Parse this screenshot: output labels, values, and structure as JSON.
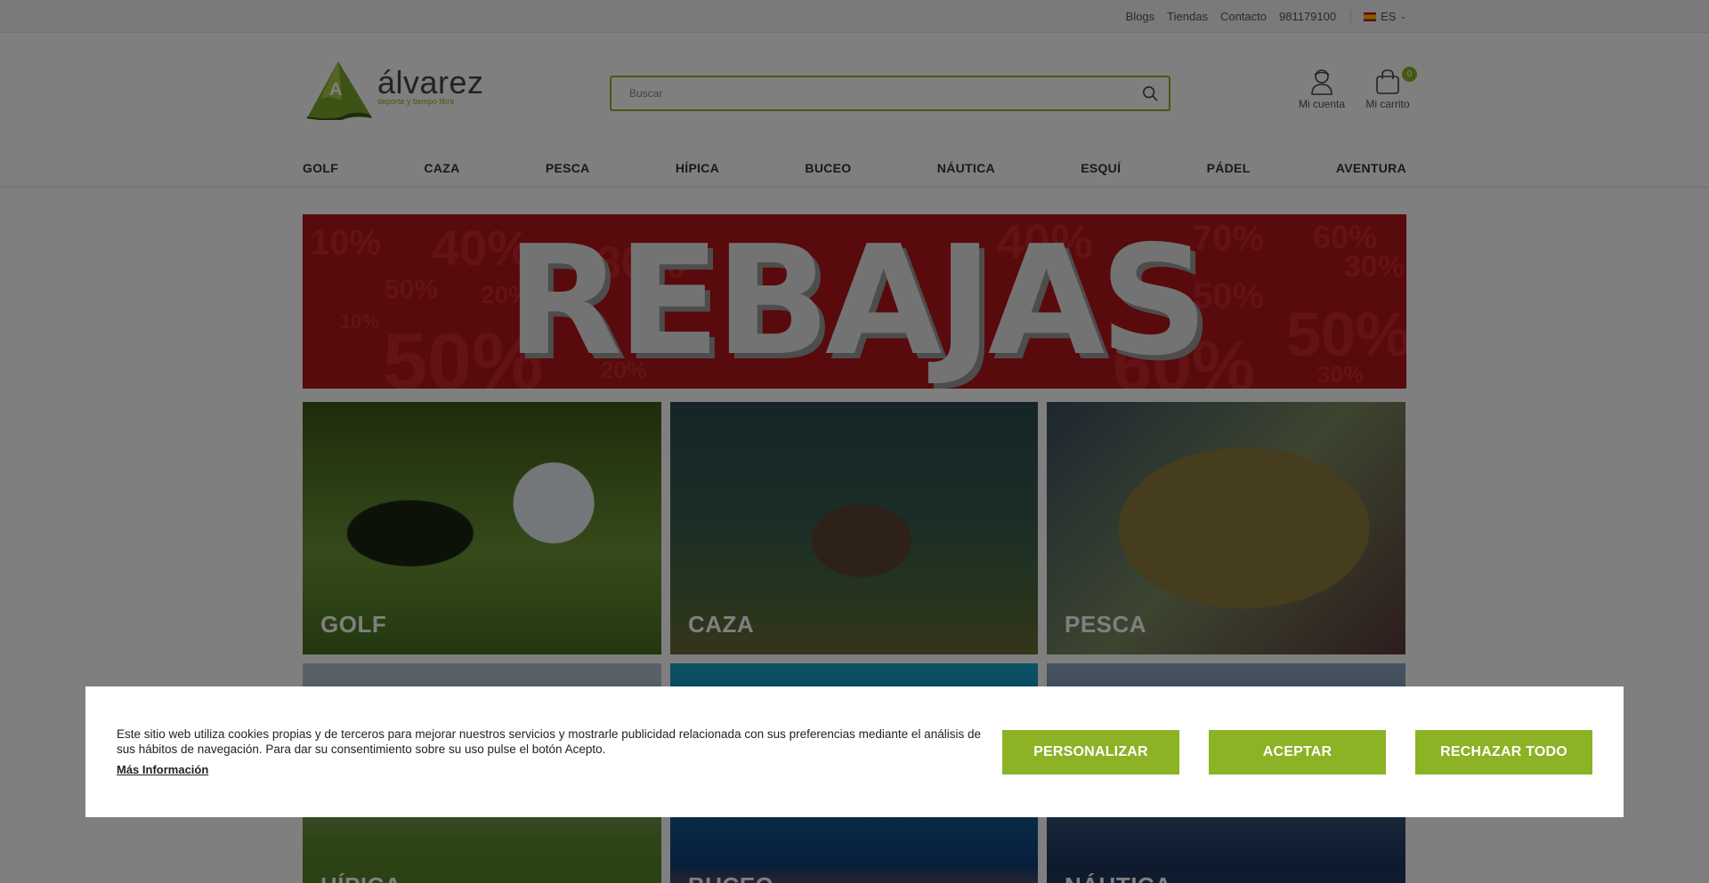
{
  "topbar": {
    "links": [
      "Blogs",
      "Tiendas",
      "Contacto",
      "981179100"
    ],
    "language": "ES"
  },
  "header": {
    "logo_word": "álvarez",
    "logo_tagline": "deporte y tiempo libre",
    "search_placeholder": "Buscar",
    "account_label": "Mi cuenta",
    "cart_label": "Mi carrito",
    "cart_count": "0"
  },
  "nav": [
    "GOLF",
    "CAZA",
    "PESCA",
    "HÍPICA",
    "BUCEO",
    "NÁUTICA",
    "ESQUÍ",
    "PÁDEL",
    "AVENTURA"
  ],
  "banner": {
    "title": "REBAJAS",
    "percentages": [
      "10%",
      "40%",
      "50%",
      "30%",
      "20%",
      "10%",
      "50%",
      "20%",
      "40%",
      "70%",
      "60%",
      "50%",
      "50%",
      "60%",
      "30%",
      "30%"
    ]
  },
  "tiles": [
    "GOLF",
    "CAZA",
    "PESCA",
    "HÍPICA",
    "BUCEO",
    "NÁUTICA"
  ],
  "cookie": {
    "text": "Este sitio web utiliza cookies propias y de terceros para mejorar nuestros servicios y mostrarle publicidad relacionada con sus preferencias mediante el análisis de sus hábitos de navegación. Para dar su consentimiento sobre su uso pulse el botón Acepto.",
    "more_link": "Más Información",
    "buttons": [
      "PERSONALIZAR",
      "ACEPTAR",
      "RECHAZAR TODO"
    ]
  },
  "colors": {
    "accent": "#8cb225",
    "banner_red": "#b0151a"
  }
}
